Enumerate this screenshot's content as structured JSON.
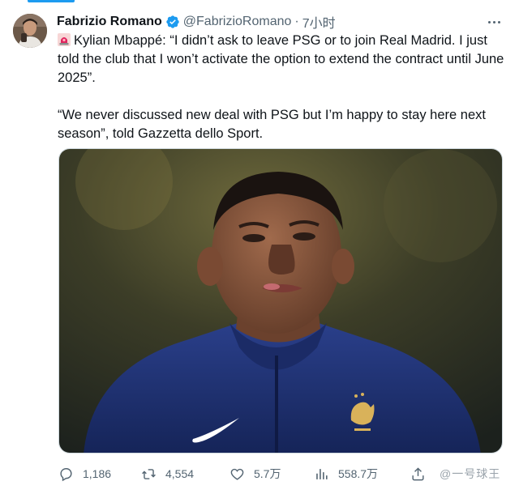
{
  "tweet": {
    "author_name": "Fabrizio Romano",
    "handle": "@FabrizioRomano",
    "separator": "·",
    "time": "7小时",
    "paragraph1": "Kylian Mbappé: “I didn’t ask to leave PSG or to join Real Madrid. I just told the club that I won’t activate the option to extend the contract until June 2025”.",
    "paragraph2": "“We never discussed new deal with PSG but I’m happy to stay here next season”, told Gazzetta dello Sport."
  },
  "icons": {
    "avatar": "profile-photo",
    "verified": "verified-badge-icon",
    "siren": "rotating-light-emoji",
    "more": "more-dots-icon",
    "reply": "reply-icon",
    "retweet": "retweet-icon",
    "like": "heart-icon",
    "views": "views-bar-chart-icon",
    "share": "share-icon"
  },
  "actions": {
    "replies": "1,186",
    "retweets": "4,554",
    "likes": "5.7万",
    "views": "558.7万"
  },
  "watermark": "@一号球王",
  "colors": {
    "accent": "#1d9bf0",
    "text": "#0f1419",
    "secondary": "#536471"
  }
}
